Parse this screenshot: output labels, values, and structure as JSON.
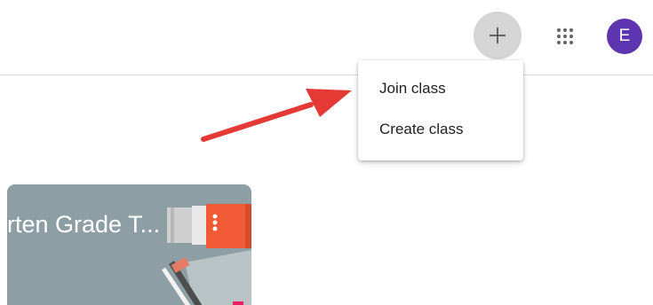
{
  "header": {
    "add_icon": "plus-icon",
    "apps_icon": "apps-grid-icon",
    "avatar_letter": "E",
    "avatar_color": "#5e35b1"
  },
  "menu": {
    "join_class": "Join class",
    "create_class": "Create class"
  },
  "annotation": {
    "arrow_color": "#e53935"
  },
  "class_card": {
    "title": "rten Grade T...",
    "menu_icon": "more-vert-icon",
    "background_color": "#8e9ea5"
  }
}
